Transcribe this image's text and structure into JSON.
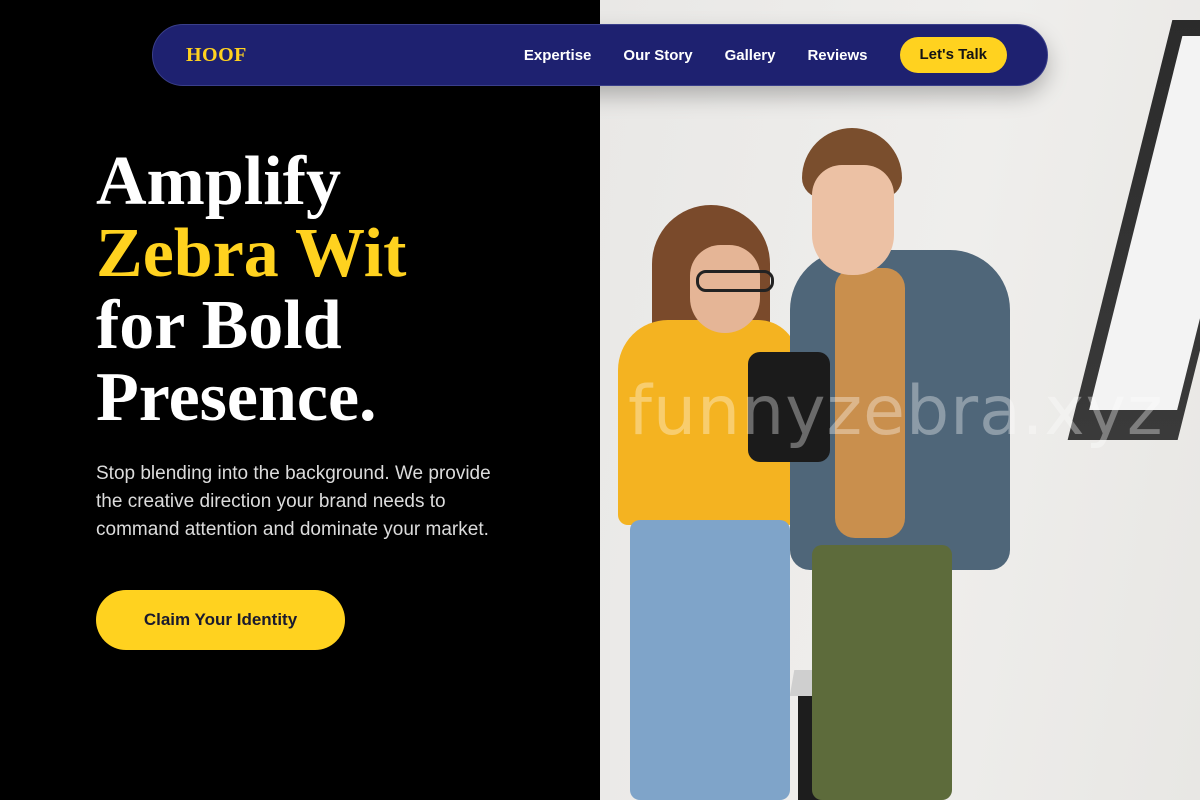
{
  "brand": {
    "logo": "HOOF",
    "accent_color": "#ffd21f",
    "nav_color": "#1e2170"
  },
  "nav": {
    "links": [
      "Expertise",
      "Our Story",
      "Gallery",
      "Reviews"
    ],
    "cta": "Let's Talk"
  },
  "hero": {
    "line1": "Amplify",
    "line2": "Zebra Wit",
    "line3": "for Bold",
    "line4": "Presence.",
    "description": "Stop blending into the background. We provide the creative direction your brand needs to command attention and dominate your market.",
    "cta": "Claim Your Identity"
  },
  "photo": {
    "watermark": "funnyzebra.xyz"
  }
}
